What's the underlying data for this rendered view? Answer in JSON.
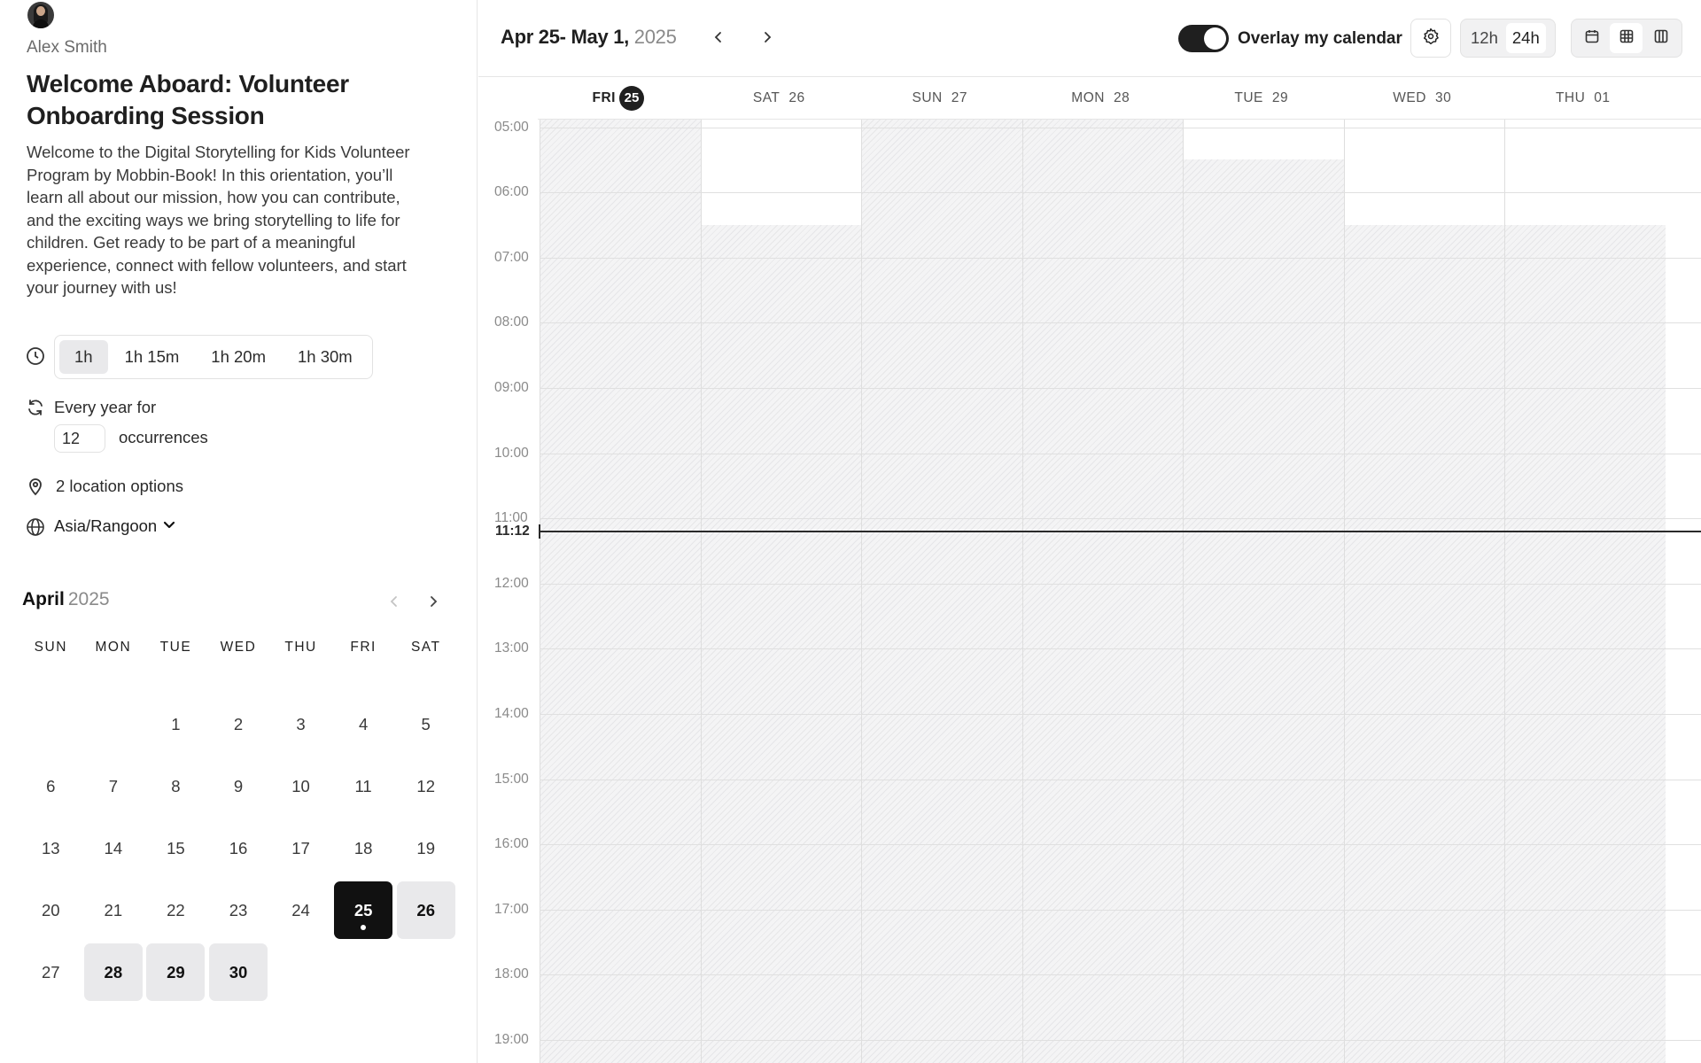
{
  "host": {
    "name": "Alex Smith",
    "avatar": "avatar"
  },
  "event": {
    "title": "Welcome Aboard: Volunteer Onboarding Session",
    "description": "Welcome to the Digital Storytelling for Kids Volunteer Program by Mobbin-Book! In this orientation, you’ll learn all about our mission, how you can contribute, and the exciting ways we bring storytelling to life for children. Get ready to be part of a meaningful experience, connect with fellow volunteers, and start your journey with us!"
  },
  "durations": {
    "icon": "clock-icon",
    "options": [
      "1h",
      "1h 15m",
      "1h 20m",
      "1h 30m"
    ],
    "selected": "1h"
  },
  "recurrence": {
    "icon": "repeat-icon",
    "label": "Every year for",
    "count": "12",
    "suffix": "occurrences"
  },
  "location": {
    "icon": "map-pin-icon",
    "label": "2 location options"
  },
  "timezone": {
    "icon": "globe-icon",
    "value": "Asia/Rangoon"
  },
  "mini_calendar": {
    "month": "April",
    "year": "2025",
    "weekdays": [
      "SUN",
      "MON",
      "TUE",
      "WED",
      "THU",
      "FRI",
      "SAT"
    ],
    "days": [
      "",
      "",
      "1",
      "2",
      "3",
      "4",
      "5",
      "6",
      "7",
      "8",
      "9",
      "10",
      "11",
      "12",
      "13",
      "14",
      "15",
      "16",
      "17",
      "18",
      "19",
      "20",
      "21",
      "22",
      "23",
      "24",
      "25",
      "26",
      "27",
      "28",
      "29",
      "30"
    ],
    "available": [
      "26",
      "28",
      "29",
      "30"
    ],
    "selected": "25"
  },
  "week_view": {
    "range_label": "Apr 25- May 1,",
    "range_year": "2025",
    "overlay_label": "Overlay my calendar",
    "overlay_on": true,
    "time_formats": [
      "12h",
      "24h"
    ],
    "time_format_selected": "24h",
    "views": [
      "month-view-icon",
      "week-view-icon",
      "column-view-icon"
    ],
    "view_selected": "week-view-icon",
    "days": [
      {
        "name": "FRI",
        "num": "25",
        "today": true
      },
      {
        "name": "SAT",
        "num": "26",
        "today": false
      },
      {
        "name": "SUN",
        "num": "27",
        "today": false
      },
      {
        "name": "MON",
        "num": "28",
        "today": false
      },
      {
        "name": "TUE",
        "num": "29",
        "today": false
      },
      {
        "name": "WED",
        "num": "30",
        "today": false
      },
      {
        "name": "THU",
        "num": "01",
        "today": false
      }
    ],
    "hours": [
      "05:00",
      "06:00",
      "07:00",
      "08:00",
      "09:00",
      "10:00",
      "11:00",
      "12:00",
      "13:00",
      "14:00",
      "15:00",
      "16:00",
      "17:00",
      "18:00",
      "19:00"
    ],
    "current_time": "11:12",
    "available_until": {
      "SAT": "06:30",
      "TUE": "05:30",
      "WED": "06:30",
      "THU": "06:30"
    }
  }
}
